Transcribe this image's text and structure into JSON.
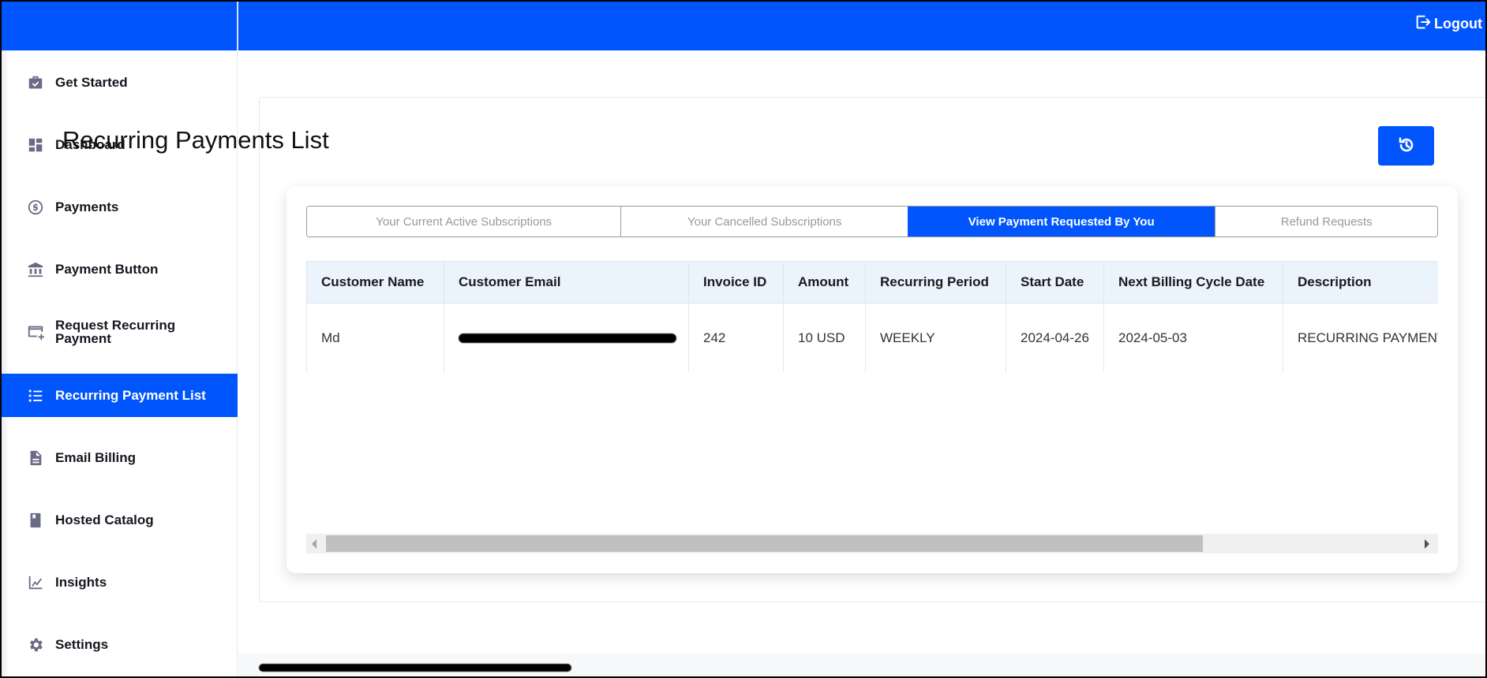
{
  "header": {
    "logout_label": "Logout",
    "brand_color": "#0055fc"
  },
  "sidebar": {
    "active_index": 5,
    "items": [
      {
        "label": "Get Started",
        "icon": "briefcase-check-icon"
      },
      {
        "label": "Dashboard",
        "icon": "dashboard-icon"
      },
      {
        "label": "Payments",
        "icon": "dollar-circle-icon"
      },
      {
        "label": "Payment Button",
        "icon": "bank-icon"
      },
      {
        "label": "Request Recurring Payment",
        "icon": "card-plus-icon"
      },
      {
        "label": "Recurring Payment List",
        "icon": "list-icon"
      },
      {
        "label": "Email Billing",
        "icon": "document-icon"
      },
      {
        "label": "Hosted Catalog",
        "icon": "book-icon"
      },
      {
        "label": "Insights",
        "icon": "chart-line-icon"
      },
      {
        "label": "Settings",
        "icon": "gear-icon"
      }
    ]
  },
  "main": {
    "title": "Recurring Payments List",
    "refresh_icon": "history-icon",
    "tabs": [
      {
        "label": "Your Current Active Subscriptions",
        "active": false
      },
      {
        "label": "Your Cancelled Subscriptions",
        "active": false
      },
      {
        "label": "View Payment Requested By You",
        "active": true
      },
      {
        "label": "Refund Requests",
        "active": false
      }
    ],
    "table": {
      "columns": [
        "Customer Name",
        "Customer Email",
        "Invoice ID",
        "Amount",
        "Recurring Period",
        "Start Date",
        "Next Billing Cycle Date",
        "Description"
      ],
      "rows": [
        {
          "customer_name": "Md",
          "customer_email": "[redacted]",
          "invoice_id": "242",
          "amount": "10 USD",
          "recurring_period": "WEEKLY",
          "start_date": "2024-04-26",
          "next_billing_cycle_date": "2024-05-03",
          "description": "RECURRING PAYMENT"
        }
      ]
    },
    "scroll": {
      "thumb_fraction": 0.78,
      "position_fraction": 0.0
    }
  },
  "footer": {
    "text": "[redacted]"
  }
}
